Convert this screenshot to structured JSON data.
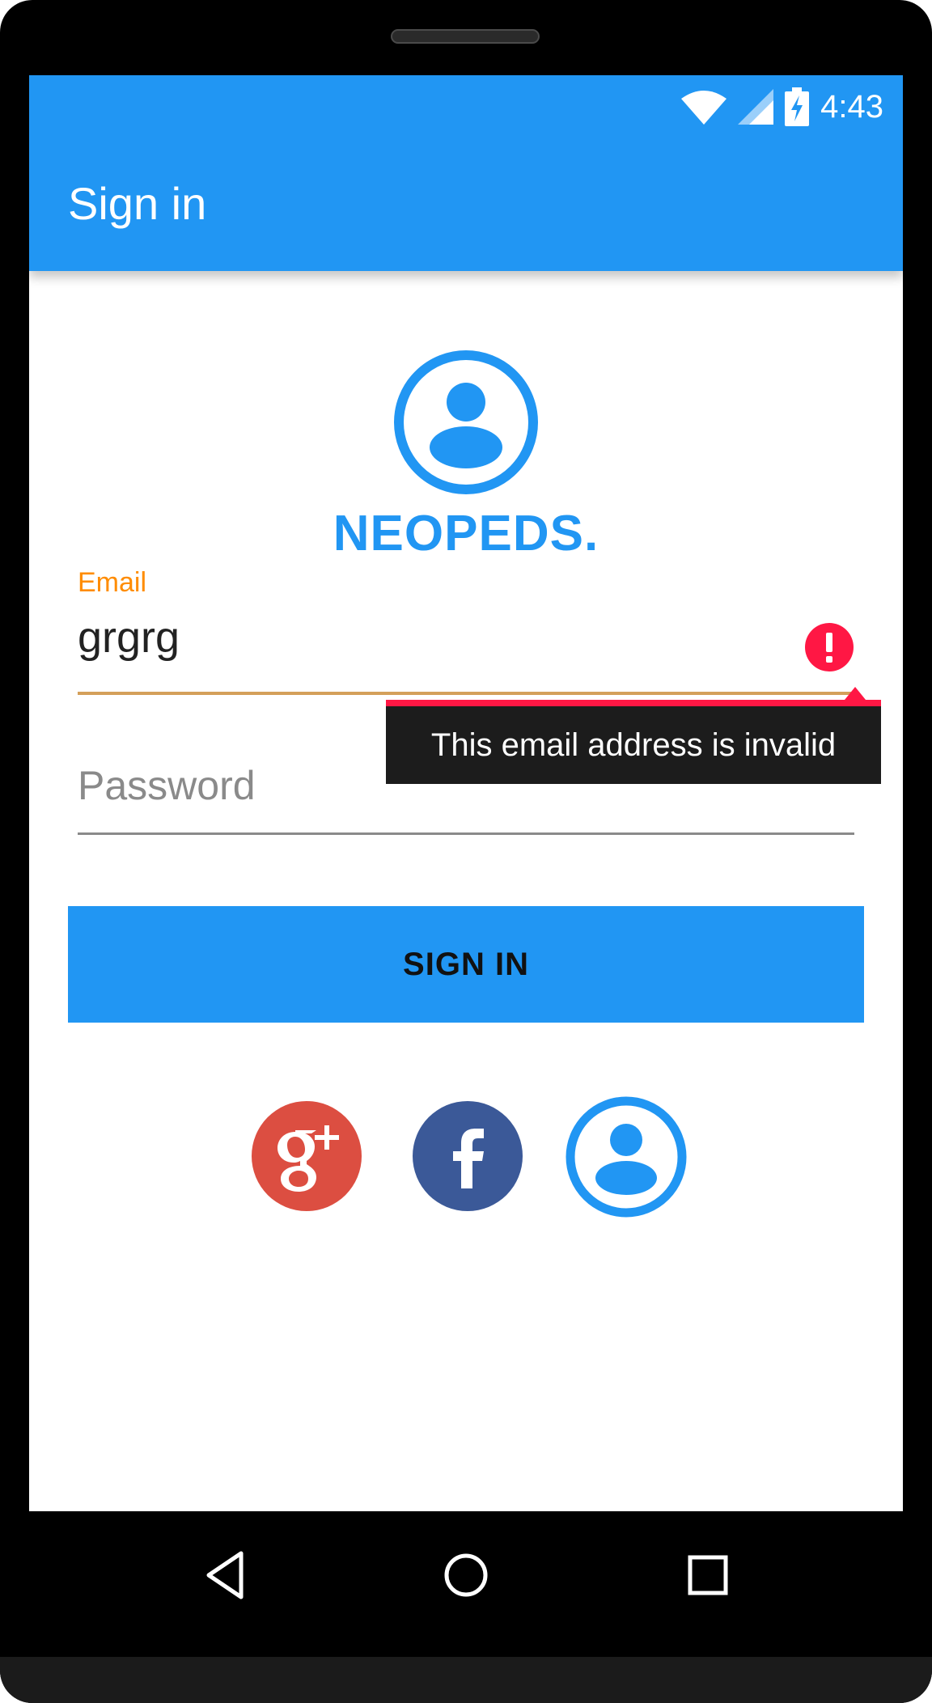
{
  "status_bar": {
    "time": "4:43",
    "icons": [
      "wifi-icon",
      "signal-icon",
      "battery-charging-icon"
    ]
  },
  "app_bar": {
    "title": "Sign in"
  },
  "logo": {
    "icon": "account-circle-icon",
    "brand": "NEOPEDS."
  },
  "form": {
    "email": {
      "label": "Email",
      "value": "grgrg",
      "error": "This email address is invalid"
    },
    "password": {
      "placeholder": "Password",
      "value": ""
    },
    "sign_in_label": "SIGN IN"
  },
  "social": [
    {
      "name": "google-plus-icon"
    },
    {
      "name": "facebook-icon"
    },
    {
      "name": "account-circle-icon"
    }
  ],
  "colors": {
    "primary": "#2196F3",
    "accent": "#FF8C00",
    "error": "#FF1744",
    "google": "#DC4E41",
    "facebook": "#3B5998"
  }
}
